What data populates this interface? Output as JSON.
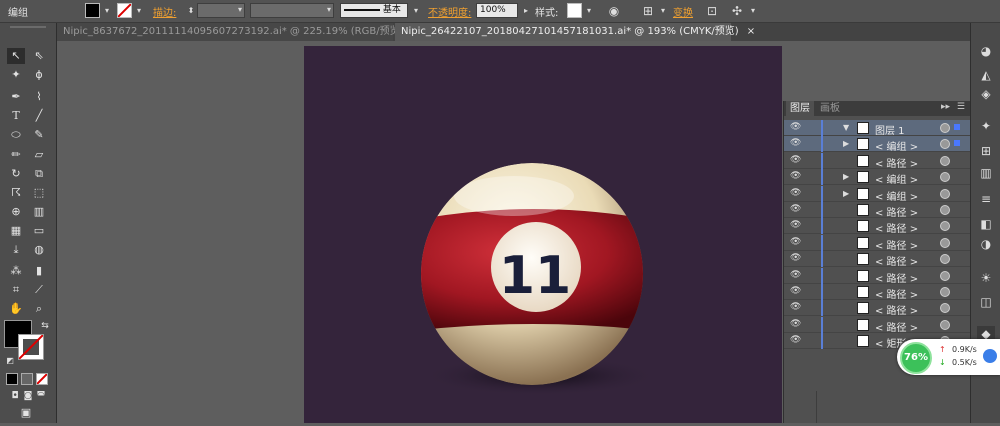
{
  "control_bar": {
    "selection_label": "编组",
    "stroke_label": "描边:",
    "stroke_profile_label": "基本",
    "opacity_label": "不透明度:",
    "opacity_value": "100%",
    "style_label": "样式:",
    "transform_label": "变换"
  },
  "tabs": [
    {
      "label": "Nipic_8637672_20111114095607273192.ai* @ 225.19% (RGB/预览)",
      "close": "×",
      "active": false
    },
    {
      "label": "Nipic_26422107_20180427101457181031.ai* @ 193% (CMYK/预览)",
      "close": "×",
      "active": true
    }
  ],
  "artwork": {
    "ball_number": "11",
    "colors": {
      "background": "#34243b",
      "cream": "#eee3c6",
      "stripe": "#a11722",
      "number": "#1a1f3a"
    }
  },
  "layers_panel": {
    "tab_layers": "图层",
    "tab_artboards": "画板",
    "rows": [
      {
        "name": "图层 1",
        "thumb": "layer-thumb",
        "expander": "▼",
        "selected": true
      },
      {
        "name": "< 编组 >",
        "thumb": "group-thumb",
        "expander": "▶",
        "selected": true
      },
      {
        "name": "< 路径 >",
        "thumb": "path-thumb",
        "expander": "",
        "selected": false
      },
      {
        "name": "< 编组 >",
        "thumb": "group-thumb",
        "expander": "▶",
        "selected": false
      },
      {
        "name": "< 编组 >",
        "thumb": "group-thumb",
        "expander": "▶",
        "selected": false
      },
      {
        "name": "< 路径 >",
        "thumb": "path-thumb",
        "expander": "",
        "selected": false
      },
      {
        "name": "< 路径 >",
        "thumb": "path-thumb",
        "expander": "",
        "selected": false
      },
      {
        "name": "< 路径 >",
        "thumb": "path-thumb",
        "expander": "",
        "selected": false
      },
      {
        "name": "< 路径 >",
        "thumb": "path-thumb",
        "expander": "",
        "selected": false
      },
      {
        "name": "< 路径 >",
        "thumb": "path-thumb",
        "expander": "",
        "selected": false
      },
      {
        "name": "< 路径 >",
        "thumb": "path-thumb",
        "expander": "",
        "selected": false
      },
      {
        "name": "< 路径 >",
        "thumb": "path-thumb",
        "expander": "",
        "selected": false
      },
      {
        "name": "< 路径 >",
        "thumb": "path-thumb",
        "expander": "",
        "selected": false
      },
      {
        "name": "< 矩形 >",
        "thumb": "rect-thumb",
        "expander": "",
        "selected": false
      }
    ]
  },
  "network_widget": {
    "percent": "76%",
    "upload": "0.9K/s",
    "download": "0.5K/s"
  }
}
